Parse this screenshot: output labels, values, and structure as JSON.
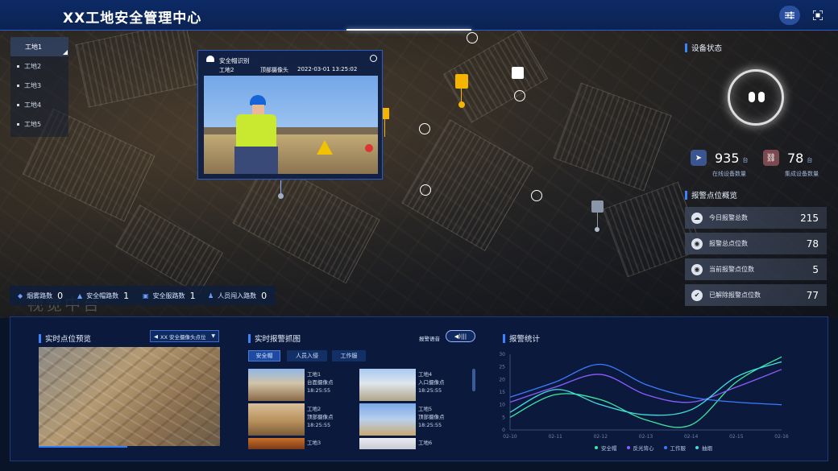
{
  "header": {
    "title": "XX工地安全管理中心"
  },
  "sites": [
    "工地1",
    "工地2",
    "工地3",
    "工地4",
    "工地5"
  ],
  "popup": {
    "title": "安全帽识别",
    "site": "工地2",
    "camera": "顶部摄像头",
    "time": "2022-03-01 13:25:02"
  },
  "stats": [
    {
      "label": "烟雾路数",
      "value": "0"
    },
    {
      "label": "安全帽路数",
      "value": "1"
    },
    {
      "label": "安全服路数",
      "value": "1"
    },
    {
      "label": "人员闯入路数",
      "value": "0"
    }
  ],
  "watermark": "视觉中台",
  "device_status": {
    "title": "设备状态",
    "online": {
      "value": "935",
      "unit": "台",
      "label": "在线设备数量"
    },
    "integrated": {
      "value": "78",
      "unit": "台",
      "label": "集成设备数量"
    }
  },
  "alarm_overview": {
    "title": "报警点位概览",
    "rows": [
      {
        "label": "今日报警总数",
        "value": "215"
      },
      {
        "label": "报警总点位数",
        "value": "78"
      },
      {
        "label": "当前报警点位数",
        "value": "5"
      },
      {
        "label": "已解除报警点位数",
        "value": "77"
      }
    ]
  },
  "preview": {
    "title": "实时点位预览",
    "select": "XX 安全摄像头点位"
  },
  "capture": {
    "title": "实时报警抓图",
    "voice_label": "报警语音",
    "tabs": [
      "安全帽",
      "人员入侵",
      "工作服"
    ],
    "items": [
      {
        "site": "工地1",
        "camera": "台面摄像点",
        "time": "18:25:55"
      },
      {
        "site": "工地4",
        "camera": "入口摄像点",
        "time": "18:25:55"
      },
      {
        "site": "工地2",
        "camera": "顶部摄像点",
        "time": "18:25:55"
      },
      {
        "site": "工地5",
        "camera": "顶部摄像点",
        "time": "18:25:55"
      },
      {
        "site": "工地3",
        "camera": "",
        "time": ""
      },
      {
        "site": "工地6",
        "camera": "",
        "time": ""
      }
    ]
  },
  "chart_data": {
    "type": "line",
    "title": "报警统计",
    "x": [
      "02-10",
      "02-11",
      "02-12",
      "02-13",
      "02-14",
      "02-15",
      "02-16"
    ],
    "ylim": [
      0,
      30
    ],
    "yticks": [
      0,
      5,
      10,
      15,
      20,
      25,
      30
    ],
    "series": [
      {
        "name": "安全帽",
        "color": "#3de8a0",
        "values": [
          5,
          14,
          12,
          4,
          2,
          19,
          29
        ]
      },
      {
        "name": "反光背心",
        "color": "#8a5cff",
        "values": [
          11,
          17,
          22,
          14,
          11,
          17,
          24
        ]
      },
      {
        "name": "工作服",
        "color": "#3b7bff",
        "values": [
          13,
          19,
          26,
          18,
          13,
          11,
          10
        ]
      },
      {
        "name": "抽烟",
        "color": "#3fe0e0",
        "values": [
          7,
          16,
          10,
          6,
          8,
          21,
          27
        ]
      }
    ]
  }
}
